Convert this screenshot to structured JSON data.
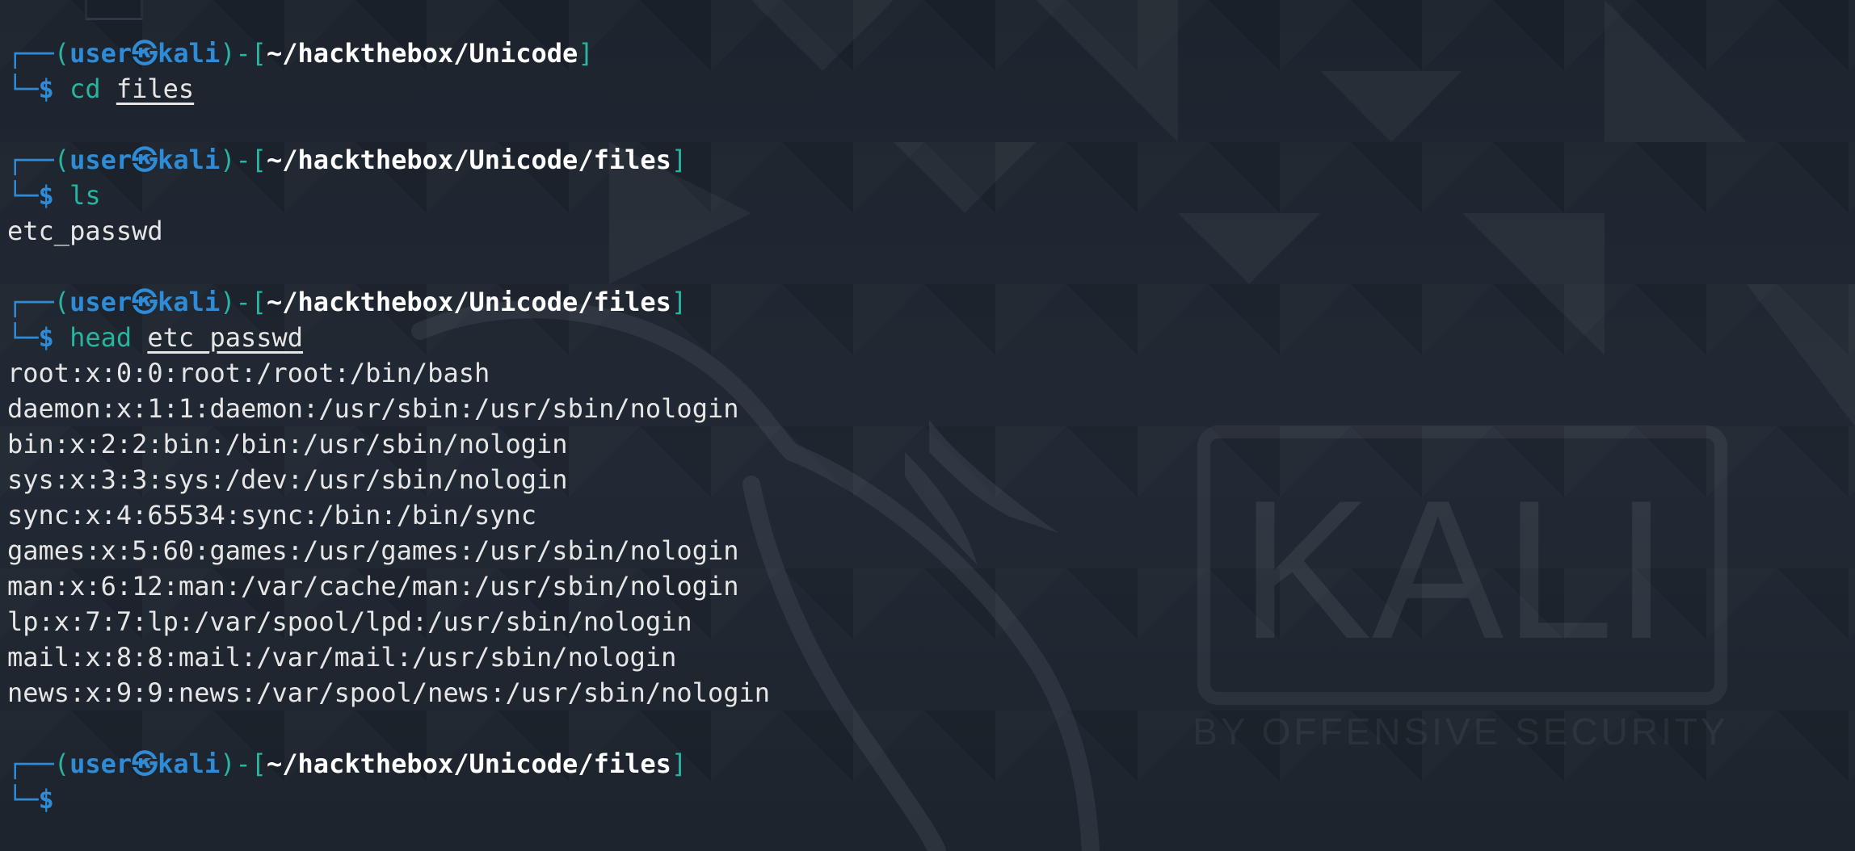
{
  "prompt": {
    "user": "user",
    "separator_glyph": "㉿",
    "host": "kali",
    "dollar": "$"
  },
  "wallpaper": {
    "logo_text": "KALI",
    "tagline": "BY OFFENSIVE SECURITY"
  },
  "session": [
    {
      "path": "~/hackthebox/Unicode",
      "cmd": "cd",
      "arg": "files",
      "output": []
    },
    {
      "path": "~/hackthebox/Unicode/files",
      "cmd": "ls",
      "arg": "",
      "output": [
        "etc_passwd"
      ]
    },
    {
      "path": "~/hackthebox/Unicode/files",
      "cmd": "head",
      "arg": "etc_passwd",
      "output": [
        "root:x:0:0:root:/root:/bin/bash",
        "daemon:x:1:1:daemon:/usr/sbin:/usr/sbin/nologin",
        "bin:x:2:2:bin:/bin:/usr/sbin/nologin",
        "sys:x:3:3:sys:/dev:/usr/sbin/nologin",
        "sync:x:4:65534:sync:/bin:/bin/sync",
        "games:x:5:60:games:/usr/games:/usr/sbin/nologin",
        "man:x:6:12:man:/var/cache/man:/usr/sbin/nologin",
        "lp:x:7:7:lp:/var/spool/lpd:/usr/sbin/nologin",
        "mail:x:8:8:mail:/var/mail:/usr/sbin/nologin",
        "news:x:9:9:news:/var/spool/news:/usr/sbin/nologin"
      ]
    },
    {
      "path": "~/hackthebox/Unicode/files",
      "cmd": "",
      "arg": "",
      "output": []
    }
  ],
  "colors": {
    "background": "#1f2630",
    "prompt_blue": "#2f8bd6",
    "command_teal": "#27b5a1",
    "text": "#e6e6e6"
  }
}
